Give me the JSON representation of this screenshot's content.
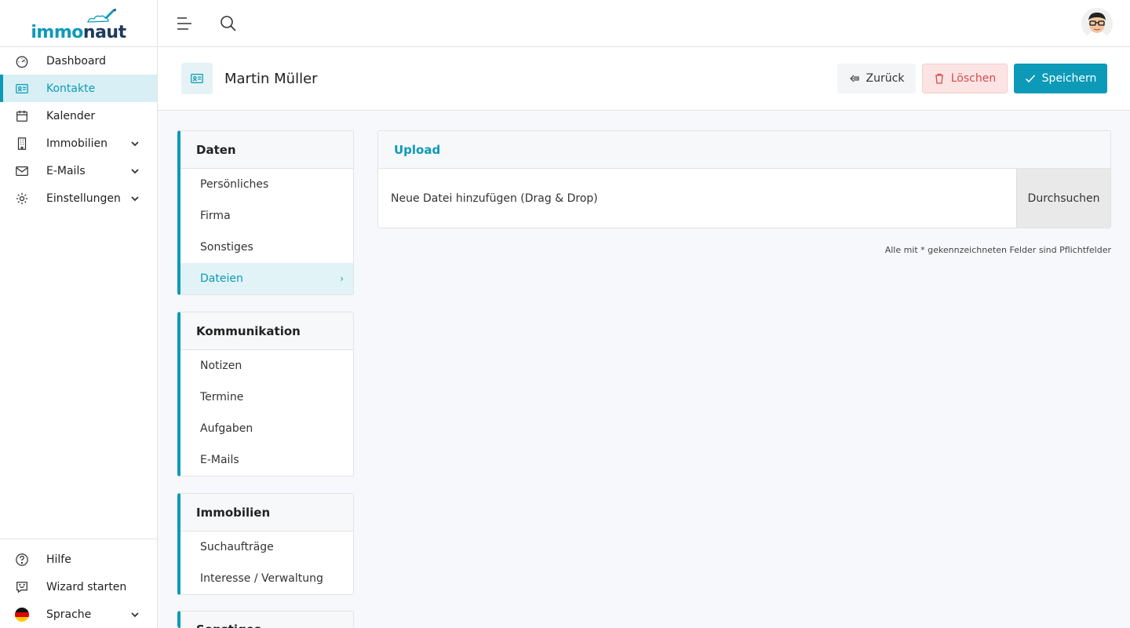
{
  "app": {
    "logo": {
      "part1": "immo",
      "part2": "naut"
    }
  },
  "sidebar": {
    "items": [
      {
        "label": "Dashboard",
        "icon": "gauge-icon"
      },
      {
        "label": "Kontakte",
        "icon": "contact-card-icon",
        "active": true
      },
      {
        "label": "Kalender",
        "icon": "calendar-icon"
      },
      {
        "label": "Immobilien",
        "icon": "building-icon",
        "expandable": true
      },
      {
        "label": "E-Mails",
        "icon": "envelope-icon",
        "expandable": true
      },
      {
        "label": "Einstellungen",
        "icon": "gear-icon",
        "expandable": true
      }
    ],
    "bottom": [
      {
        "label": "Hilfe",
        "icon": "help-circle-icon"
      },
      {
        "label": "Wizard starten",
        "icon": "chat-smile-icon"
      },
      {
        "label": "Sprache",
        "icon": "flag-de-icon",
        "expandable": true
      }
    ]
  },
  "header": {
    "title": "Martin Müller",
    "back_label": "Zurück",
    "delete_label": "Löschen",
    "save_label": "Speichern"
  },
  "subnav": {
    "daten": {
      "title": "Daten",
      "items": [
        "Persönliches",
        "Firma",
        "Sonstiges",
        "Dateien"
      ],
      "active": "Dateien"
    },
    "kommunikation": {
      "title": "Kommunikation",
      "items": [
        "Notizen",
        "Termine",
        "Aufgaben",
        "E-Mails"
      ]
    },
    "immobilien": {
      "title": "Immobilien",
      "items": [
        "Suchaufträge",
        "Interesse / Verwaltung"
      ]
    },
    "sonstiges": {
      "title": "Sonstiges"
    }
  },
  "upload": {
    "title": "Upload",
    "drop_text": "Neue Datei hinzufügen (Drag & Drop)",
    "browse_label": "Durchsuchen"
  },
  "footnote": "Alle mit * gekennzeichneten Felder sind Pflichtfelder",
  "colors": {
    "accent": "#0d9ab8",
    "danger": "#d94b4b",
    "danger_bg": "#fde4e4"
  }
}
